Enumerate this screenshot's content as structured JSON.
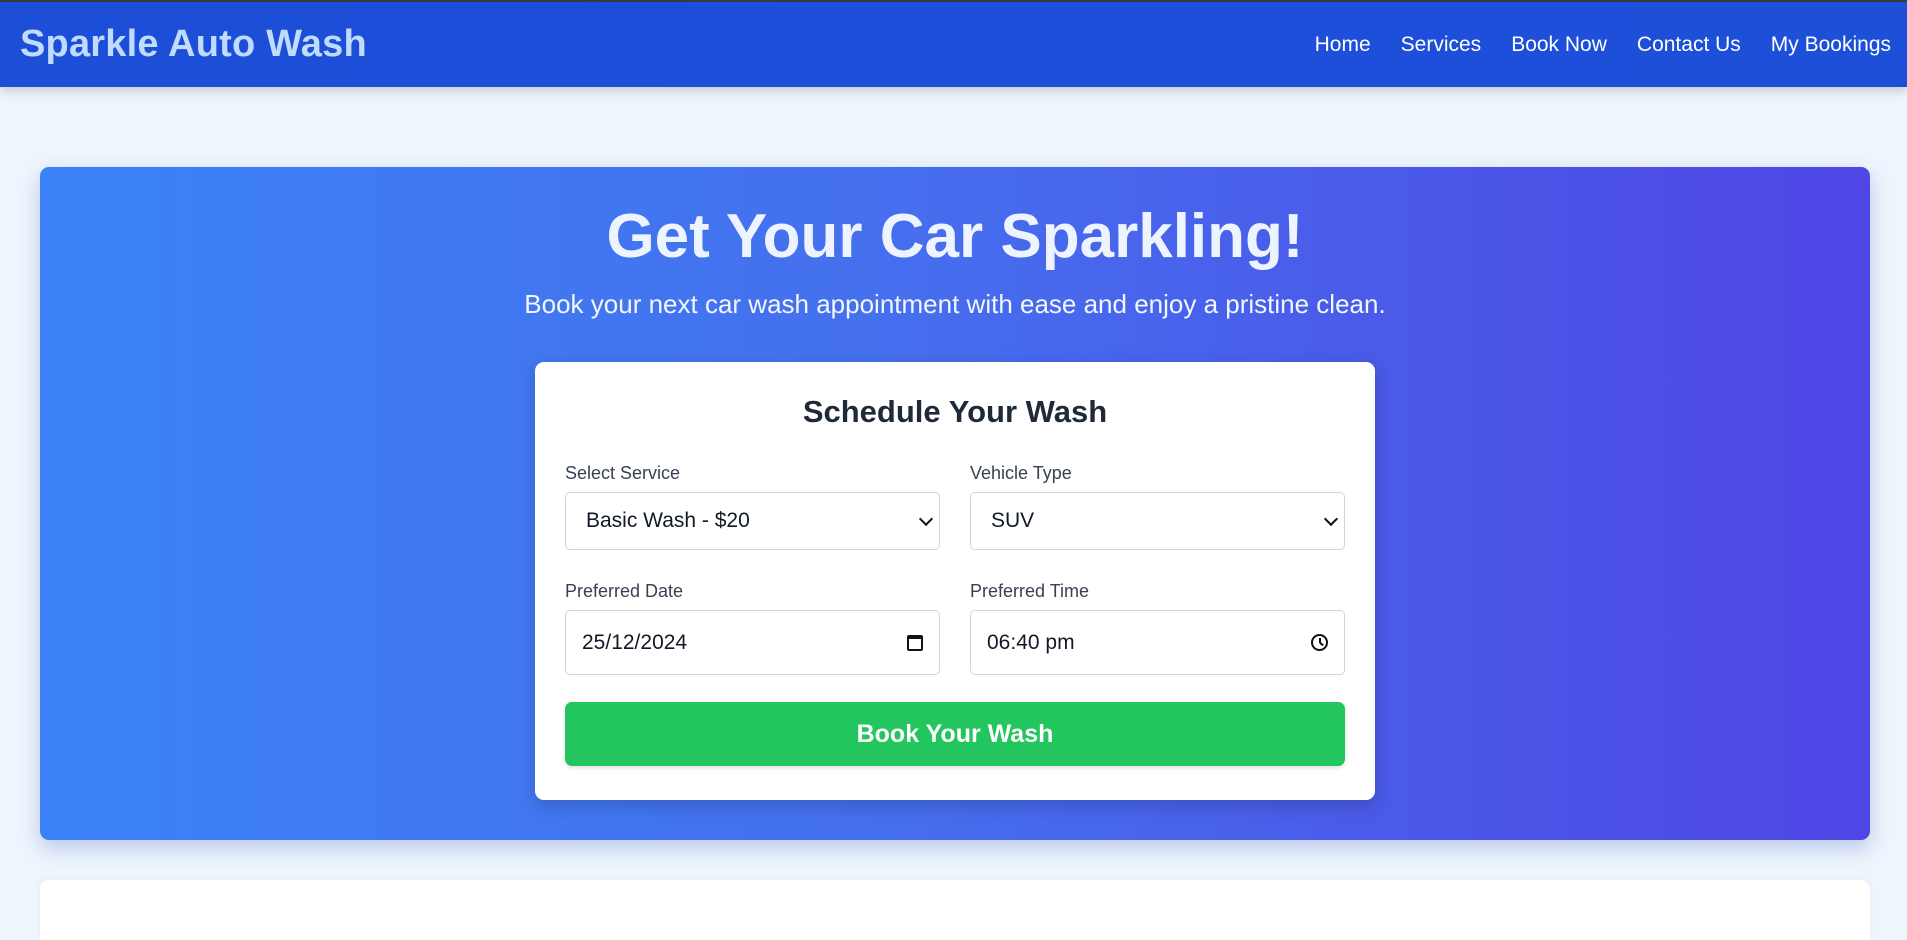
{
  "header": {
    "brand": "Sparkle Auto Wash",
    "nav": [
      {
        "label": "Home"
      },
      {
        "label": "Services"
      },
      {
        "label": "Book Now"
      },
      {
        "label": "Contact Us"
      },
      {
        "label": "My Bookings"
      }
    ]
  },
  "hero": {
    "title": "Get Your Car Sparkling!",
    "subtitle": "Book your next car wash appointment with ease and enjoy a pristine clean."
  },
  "form": {
    "title": "Schedule Your Wash",
    "service": {
      "label": "Select Service",
      "value": "Basic Wash - $20"
    },
    "vehicle": {
      "label": "Vehicle Type",
      "value": "SUV"
    },
    "date": {
      "label": "Preferred Date",
      "value": "25/12/2024"
    },
    "time": {
      "label": "Preferred Time",
      "value": "06:40 pm"
    },
    "submit_label": "Book Your Wash"
  },
  "colors": {
    "nav_bg": "#1d4ed8",
    "brand_text": "#bfdbfe",
    "hero_gradient_start": "#3b82f6",
    "hero_gradient_end": "#4f46e5",
    "submit_bg": "#22c55e",
    "page_bg": "#eef5fd"
  },
  "icons": [
    "chevron-down-icon",
    "calendar-icon",
    "clock-icon"
  ]
}
